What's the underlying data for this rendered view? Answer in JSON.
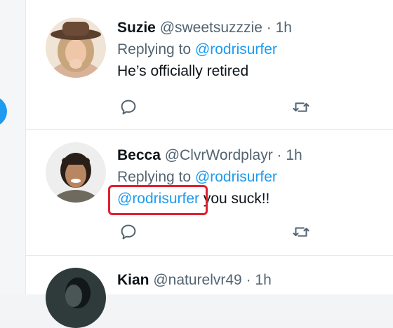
{
  "tweets": [
    {
      "name": "Suzie",
      "handle": "@sweetsuzzzie",
      "time": "· 1h",
      "reply_prefix": "Replying to",
      "reply_to": "@rodrisurfer",
      "text": "He’s officially retired"
    },
    {
      "name": "Becca",
      "handle": "@ClvrWordplayr",
      "time": "· 1h",
      "reply_prefix": "Replying to",
      "reply_to": "@rodrisurfer",
      "mention": "@rodrisurfer",
      "text": " you suck!!"
    },
    {
      "name": "Kian",
      "handle": "@naturelvr49",
      "time": "· 1h"
    }
  ],
  "icons": {
    "reply": "reply-icon",
    "retweet": "retweet-icon"
  },
  "colors": {
    "link": "#1d9bf0",
    "secondary_text": "#536471",
    "highlight_box": "#e0202f"
  }
}
